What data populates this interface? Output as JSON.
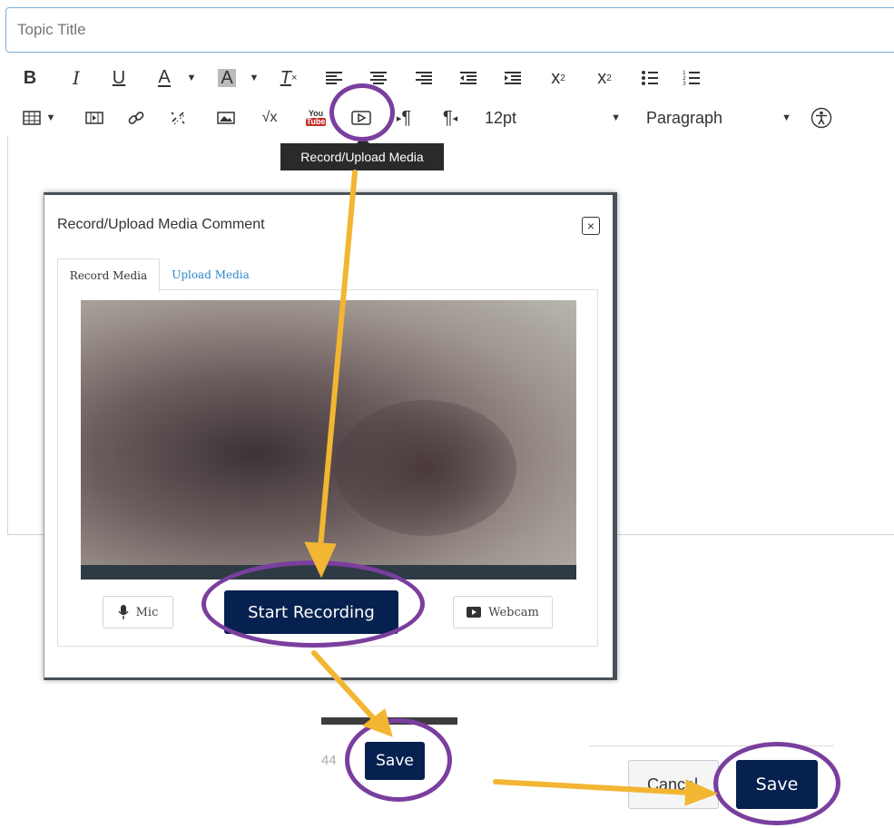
{
  "title_placeholder": "Topic Title",
  "toolbar": {
    "font_size": "12pt",
    "block_format": "Paragraph"
  },
  "tooltip": "Record/Upload Media",
  "dialog": {
    "title": "Record/Upload Media Comment",
    "tabs": [
      {
        "label": "Record Media",
        "active": true
      },
      {
        "label": "Upload Media",
        "active": false
      }
    ],
    "mic_label": "Mic",
    "start_recording_label": "Start Recording",
    "webcam_label": "Webcam"
  },
  "bottom": {
    "partial_text": "44",
    "save_small": "Save",
    "cancel": "Cancel",
    "save": "Save"
  },
  "colors": {
    "navy": "#06204f",
    "highlight": "#7a3f9e",
    "arrow": "#f2b632"
  }
}
